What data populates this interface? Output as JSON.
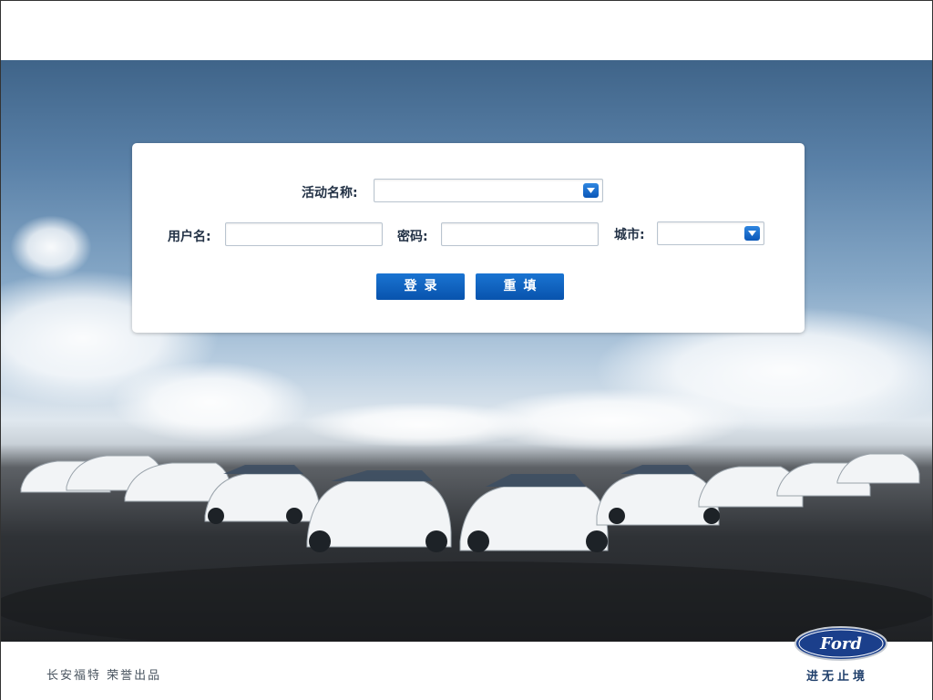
{
  "login_form": {
    "activity_label": "活动名称:",
    "activity_value": "",
    "username_label": "用户名:",
    "username_value": "",
    "password_label": "密码:",
    "password_value": "",
    "city_label": "城市:",
    "city_value": "",
    "login_button": "登录",
    "reset_button": "重填"
  },
  "footer": {
    "credit": "长安福特 荣誉出品",
    "brand_logo_text": "Ford",
    "slogan": "进无止境"
  },
  "icons": {
    "dropdown": "chevron-down-icon",
    "logo": "ford-logo"
  },
  "colors": {
    "button": "#0a5bb8",
    "label": "#233246",
    "ford_blue": "#1b3f8b"
  }
}
